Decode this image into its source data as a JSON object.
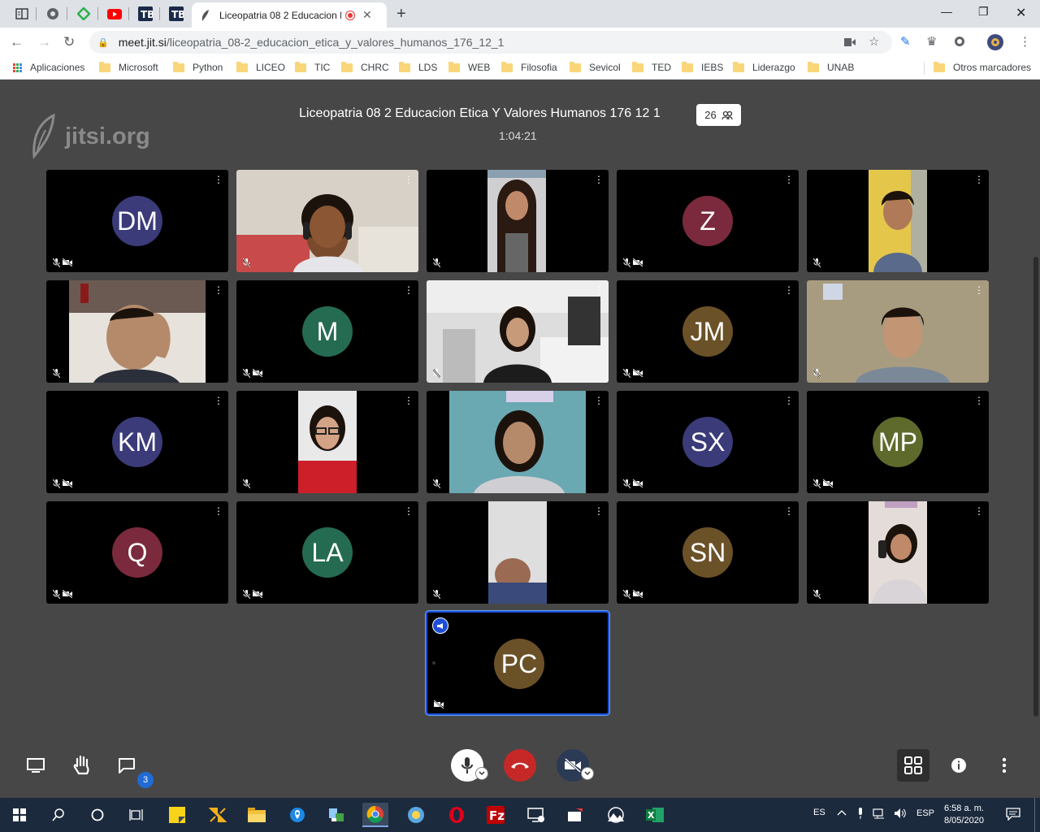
{
  "browser": {
    "tab_title": "Liceopatria 08 2 Educacion E",
    "url_host": "meet.jit.si",
    "url_path": "/liceopatria_08-2_educacion_etica_y_valores_humanos_176_12_1",
    "pinned_tabs": [
      "reader-icon",
      "globe-icon",
      "feedly-icon",
      "youtube-icon",
      "tb-icon",
      "tb-icon"
    ]
  },
  "bookmarks": {
    "apps": "Aplicaciones",
    "items": [
      "Microsoft",
      "Python",
      "LICEO",
      "TIC",
      "CHRC",
      "LDS",
      "WEB",
      "Filosofia",
      "Sevicol",
      "TED",
      "IEBS",
      "Liderazgo",
      "UNAB"
    ],
    "other": "Otros marcadores"
  },
  "meeting": {
    "logo": "jitsi.org",
    "title": "Liceopatria 08 2 Educacion Etica Y Valores Humanos 176 12 1",
    "participant_count": "26",
    "timer": "1:04:21"
  },
  "participants": [
    {
      "initials": "DM",
      "color": "#3b3b7a",
      "video": false
    },
    {
      "initials": "",
      "video": true,
      "scene": "girl-headphones"
    },
    {
      "initials": "",
      "video": true,
      "scene": "girl-long-hair"
    },
    {
      "initials": "Z",
      "color": "#7a2a3c",
      "video": false
    },
    {
      "initials": "",
      "video": true,
      "scene": "boy-yellow"
    },
    {
      "initials": "",
      "video": true,
      "scene": "boy-hand-head"
    },
    {
      "initials": "M",
      "color": "#256b52",
      "video": false
    },
    {
      "initials": "",
      "video": true,
      "scene": "girl-room"
    },
    {
      "initials": "JM",
      "color": "#6b5128",
      "video": false
    },
    {
      "initials": "",
      "video": true,
      "scene": "boy-wall"
    },
    {
      "initials": "KM",
      "color": "#3b3b7a",
      "video": false
    },
    {
      "initials": "",
      "video": true,
      "scene": "girl-glasses"
    },
    {
      "initials": "",
      "video": true,
      "scene": "girl-teal"
    },
    {
      "initials": "SX",
      "color": "#3b3b7a",
      "video": false
    },
    {
      "initials": "MP",
      "color": "#5e6a2c",
      "video": false
    },
    {
      "initials": "Q",
      "color": "#7a2a3c",
      "video": false
    },
    {
      "initials": "LA",
      "color": "#256b52",
      "video": false
    },
    {
      "initials": "",
      "video": true,
      "scene": "blurry"
    },
    {
      "initials": "SN",
      "color": "#6b5128",
      "video": false
    },
    {
      "initials": "",
      "video": true,
      "scene": "girl-phone"
    }
  ],
  "local": {
    "initials": "PC",
    "color": "#6b5128"
  },
  "toolbar": {
    "chat_unread": "3"
  },
  "taskbar": {
    "lang_short": "ES",
    "lang": "ESP",
    "time": "6:58 a. m.",
    "date": "8/05/2020"
  }
}
